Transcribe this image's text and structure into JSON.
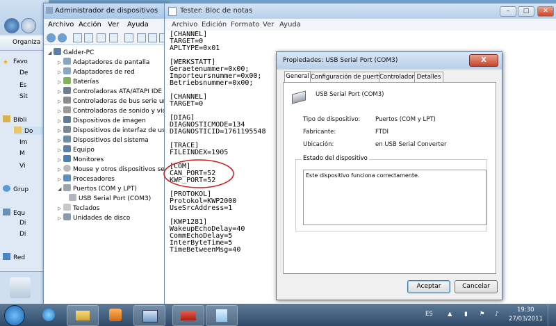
{
  "explorer": {
    "organize_label": "Organiza",
    "nav": [
      "Favo",
      "De",
      "Es",
      "Sit",
      "Bibli",
      "Do",
      "Im",
      "M",
      "Vi",
      "Grup",
      "Equ",
      "Di",
      "Di",
      "Red"
    ]
  },
  "device_manager": {
    "title": "Administrador de dispositivos",
    "menu": [
      "Archivo",
      "Acción",
      "Ver",
      "Ayuda"
    ],
    "root": "Galder-PC",
    "items": [
      "Adaptadores de pantalla",
      "Adaptadores de red",
      "Baterías",
      "Controladoras ATA/ATAPI IDE",
      "Controladoras de bus serie un",
      "Controladoras de sonido y vid",
      "Dispositivos de imagen",
      "Dispositivos de interfaz de us",
      "Dispositivos del sistema",
      "Equipo",
      "Monitores",
      "Mouse y otros dispositivos se",
      "Procesadores",
      "Puertos (COM y LPT)",
      "USB Serial Port (COM3)",
      "Teclados",
      "Unidades de disco"
    ]
  },
  "notepad": {
    "title": "Tester: Bloc de notas",
    "menu": [
      "Archivo",
      "Edición",
      "Formato",
      "Ver",
      "Ayuda"
    ],
    "lines": [
      "[CHANNEL]",
      "TARGET=0",
      "APLTYPE=0x01",
      "",
      "[WERKSTATT]",
      "Geraetenummer=0x00;",
      "Importeursnummer=0x00;",
      "Betriebsnummer=0x00;",
      "",
      "[CHANNEL]",
      "TARGET=0",
      "",
      "[DIAG]",
      "DIAGNOSTICMODE=134",
      "DIAGNOSTICID=1761195548",
      "",
      "[TRACE]",
      "FILEINDEX=1905",
      "",
      "[COM]",
      "CAN_PORT=52",
      "KWP_PORT=52",
      "",
      "[PROTOKOL]",
      "Protokol=KWP2000",
      "UseSrcAddress=1",
      "",
      "[KWP1281]",
      "WakeupEchoDelay=40",
      "CommEchoDelay=5",
      "InterByteTime=5",
      "TimeBetweenMsg=40"
    ]
  },
  "dialog": {
    "title": "Propiedades: USB Serial Port (COM3)",
    "close": "X",
    "tabs": [
      "General",
      "Configuración de puerto",
      "Controlador",
      "Detalles"
    ],
    "device_name": "USB Serial Port (COM3)",
    "fields": [
      {
        "label": "Tipo de dispositivo:",
        "value": "Puertos (COM y LPT)"
      },
      {
        "label": "Fabricante:",
        "value": "FTDI"
      },
      {
        "label": "Ubicación:",
        "value": "en USB Serial Converter"
      }
    ],
    "status_group": "Estado del dispositivo",
    "status_text": "Este dispositivo funciona correctamente.",
    "ok_label": "Aceptar",
    "cancel_label": "Cancelar"
  },
  "taskbar": {
    "language": "ES",
    "time": "19:30",
    "date": "27/03/2011"
  },
  "colors": {
    "annotation_circle": "#d11a1a",
    "taskbar": "#2d4a68",
    "titlebar": "#b8cfe9"
  }
}
